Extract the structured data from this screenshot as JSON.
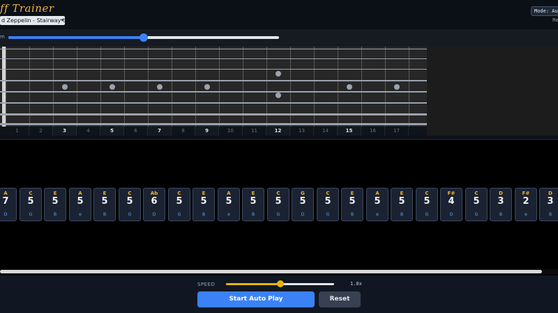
{
  "header": {
    "title": "ff Trainer",
    "song_selected": "d Zeppelin - Stairway to He",
    "mode_label": "Mode: Auto",
    "reset_label": "Re"
  },
  "zoom": {
    "label": "m",
    "value": 0.5
  },
  "fretboard": {
    "fret_numbers": [
      "1",
      "2",
      "3",
      "4",
      "5",
      "6",
      "7",
      "8",
      "9",
      "10",
      "11",
      "12",
      "13",
      "14",
      "15",
      "16",
      "17"
    ],
    "marked_frets": [
      "3",
      "5",
      "7",
      "9",
      "12",
      "15"
    ],
    "inlay_frets": [
      3,
      5,
      7,
      9,
      15,
      17
    ],
    "double_inlay_fret": 12
  },
  "tabs": [
    {
      "note": "A",
      "fret": "7",
      "string": "D"
    },
    {
      "note": "C",
      "fret": "5",
      "string": "G"
    },
    {
      "note": "E",
      "fret": "5",
      "string": "B"
    },
    {
      "note": "A",
      "fret": "5",
      "string": "e"
    },
    {
      "note": "E",
      "fret": "5",
      "string": "B"
    },
    {
      "note": "C",
      "fret": "5",
      "string": "G"
    },
    {
      "note": "Ab",
      "fret": "6",
      "string": "D"
    },
    {
      "note": "C",
      "fret": "5",
      "string": "G"
    },
    {
      "note": "E",
      "fret": "5",
      "string": "B"
    },
    {
      "note": "A",
      "fret": "5",
      "string": "e"
    },
    {
      "note": "E",
      "fret": "5",
      "string": "B"
    },
    {
      "note": "C",
      "fret": "5",
      "string": "G"
    },
    {
      "note": "G",
      "fret": "5",
      "string": "D"
    },
    {
      "note": "C",
      "fret": "5",
      "string": "G"
    },
    {
      "note": "E",
      "fret": "5",
      "string": "B"
    },
    {
      "note": "A",
      "fret": "5",
      "string": "e"
    },
    {
      "note": "E",
      "fret": "5",
      "string": "B"
    },
    {
      "note": "C",
      "fret": "5",
      "string": "G"
    },
    {
      "note": "F#",
      "fret": "4",
      "string": "D"
    },
    {
      "note": "C",
      "fret": "5",
      "string": "G"
    },
    {
      "note": "D",
      "fret": "3",
      "string": "B"
    },
    {
      "note": "F#",
      "fret": "2",
      "string": "e"
    },
    {
      "note": "D",
      "fret": "3",
      "string": "B"
    }
  ],
  "controls": {
    "speed_label": "SPEED",
    "speed_value": "1.0x",
    "speed_fraction": 0.5,
    "start_label": "Start Auto Play",
    "reset_label": "Reset"
  },
  "colors": {
    "accent": "#3b82f6",
    "note": "#f0b43a",
    "string_label": "#60a5fa",
    "speed": "#eab308"
  }
}
